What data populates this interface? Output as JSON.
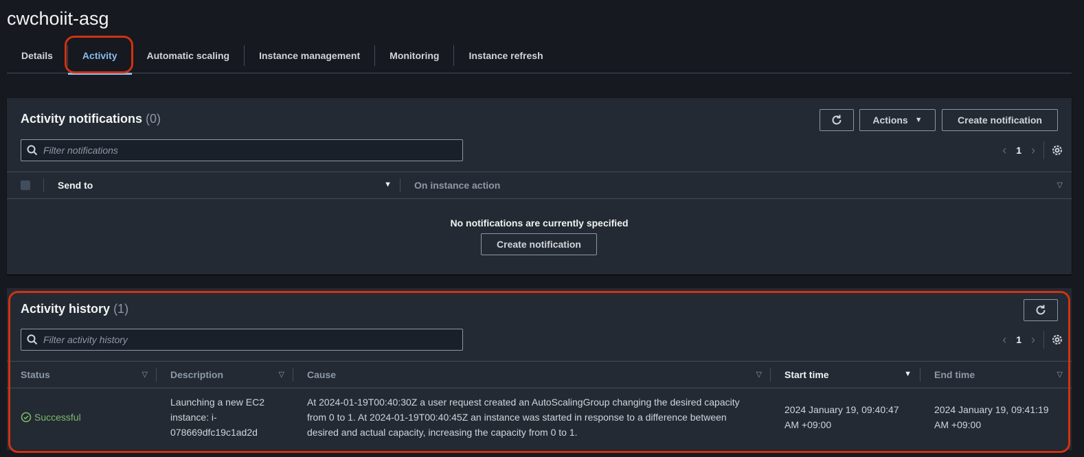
{
  "page": {
    "title": "cwchoiit-asg"
  },
  "tabs": [
    {
      "label": "Details"
    },
    {
      "label": "Activity"
    },
    {
      "label": "Automatic scaling"
    },
    {
      "label": "Instance management"
    },
    {
      "label": "Monitoring"
    },
    {
      "label": "Instance refresh"
    }
  ],
  "notifications": {
    "title": "Activity notifications",
    "count": "(0)",
    "actions_label": "Actions",
    "create_label": "Create notification",
    "search_placeholder": "Filter notifications",
    "page": "1",
    "columns": {
      "send_to": "Send to",
      "on_instance_action": "On instance action"
    },
    "empty_message": "No notifications are currently specified",
    "empty_create_label": "Create notification"
  },
  "history": {
    "title": "Activity history",
    "count": "(1)",
    "search_placeholder": "Filter activity history",
    "page": "1",
    "columns": {
      "status": "Status",
      "description": "Description",
      "cause": "Cause",
      "start_time": "Start time",
      "end_time": "End time"
    },
    "rows": [
      {
        "status": "Successful",
        "description_lines": [
          "Launching a new EC2",
          "instance: i-",
          "078669dfc19c1ad2d"
        ],
        "cause_lines": [
          "At 2024-01-19T00:40:30Z a user request created an AutoScalingGroup changing the desired capacity",
          "from 0 to 1. At 2024-01-19T00:40:45Z an instance was started in response to a difference between",
          "desired and actual capacity, increasing the capacity from 0 to 1."
        ],
        "start_time_lines": [
          "2024 January 19, 09:40:47",
          "AM +09:00"
        ],
        "end_time_lines": [
          "2024 January 19, 09:41:19",
          "AM +09:00"
        ]
      }
    ]
  },
  "colors": {
    "background": "#16191f",
    "panel": "#232a33",
    "active_tab": "#89bdee",
    "success": "#7fba6b",
    "highlight": "#d13212"
  }
}
